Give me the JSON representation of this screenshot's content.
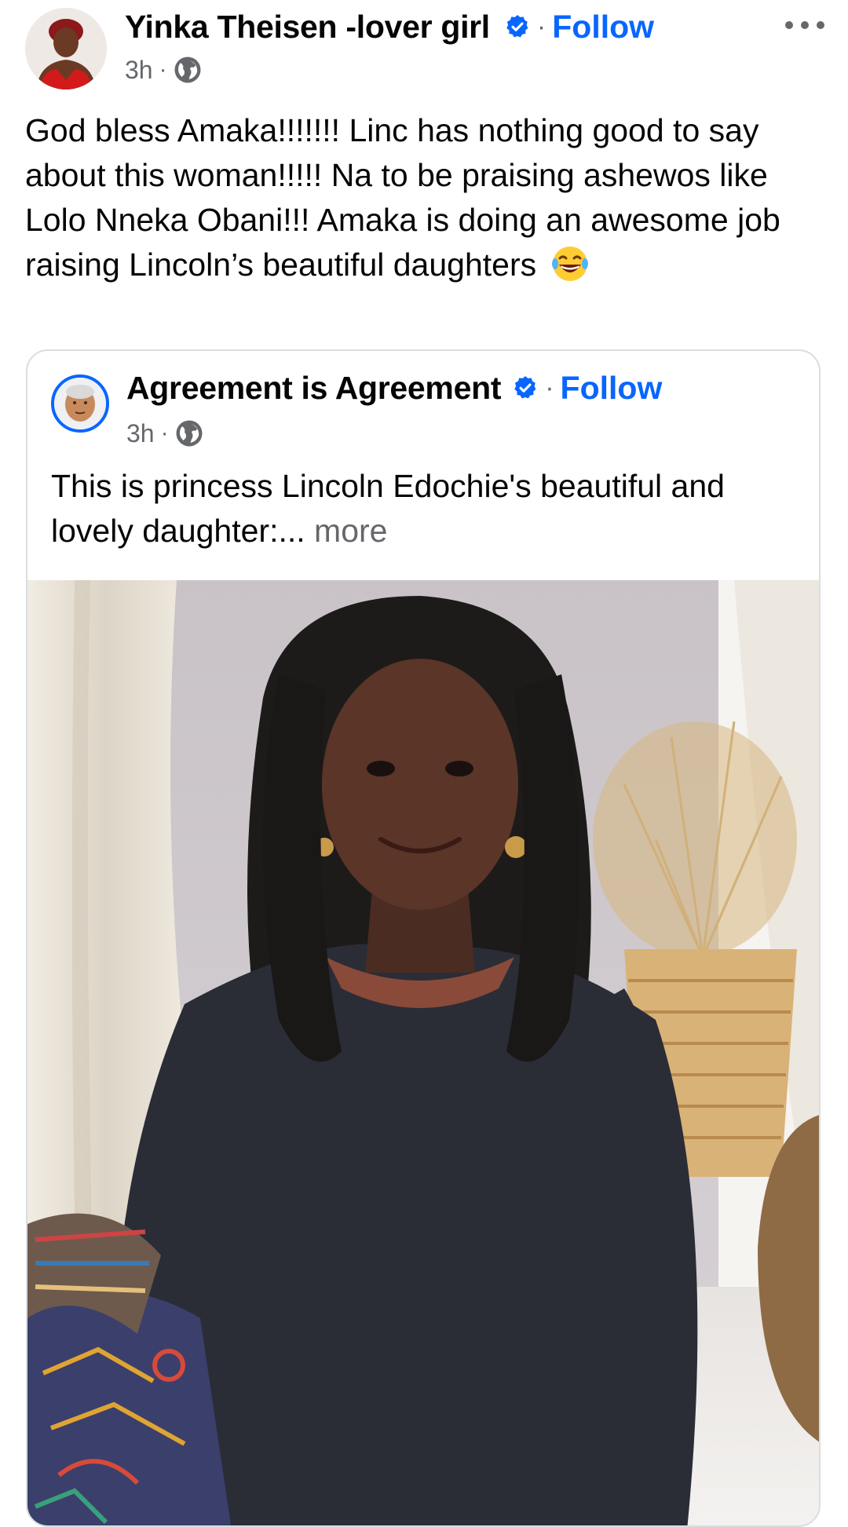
{
  "post": {
    "author": "Yinka Theisen -lover girl",
    "follow_label": "Follow",
    "separator": "·",
    "time": "3h",
    "text": "God bless Amaka!!!!!!! Linc has nothing good to say about this woman!!!!! Na to be praising ashewos like Lolo Nneka Obani!!! Amaka is doing an awesome job raising Lincoln’s beautiful daughters",
    "emoji": "😂"
  },
  "shared": {
    "author": "Agreement is Agreement",
    "follow_label": "Follow",
    "separator": "·",
    "time": "3h",
    "text": "This is princess Lincoln Edochie's beautiful and lovely daughter:...",
    "more_label": "more"
  },
  "icons": {
    "verified": "verified-badge-icon",
    "audience": "globe-icon",
    "menu": "more-options-icon"
  },
  "colors": {
    "link_blue": "#0866ff",
    "secondary_text": "#65676b",
    "primary_text": "#050505"
  }
}
